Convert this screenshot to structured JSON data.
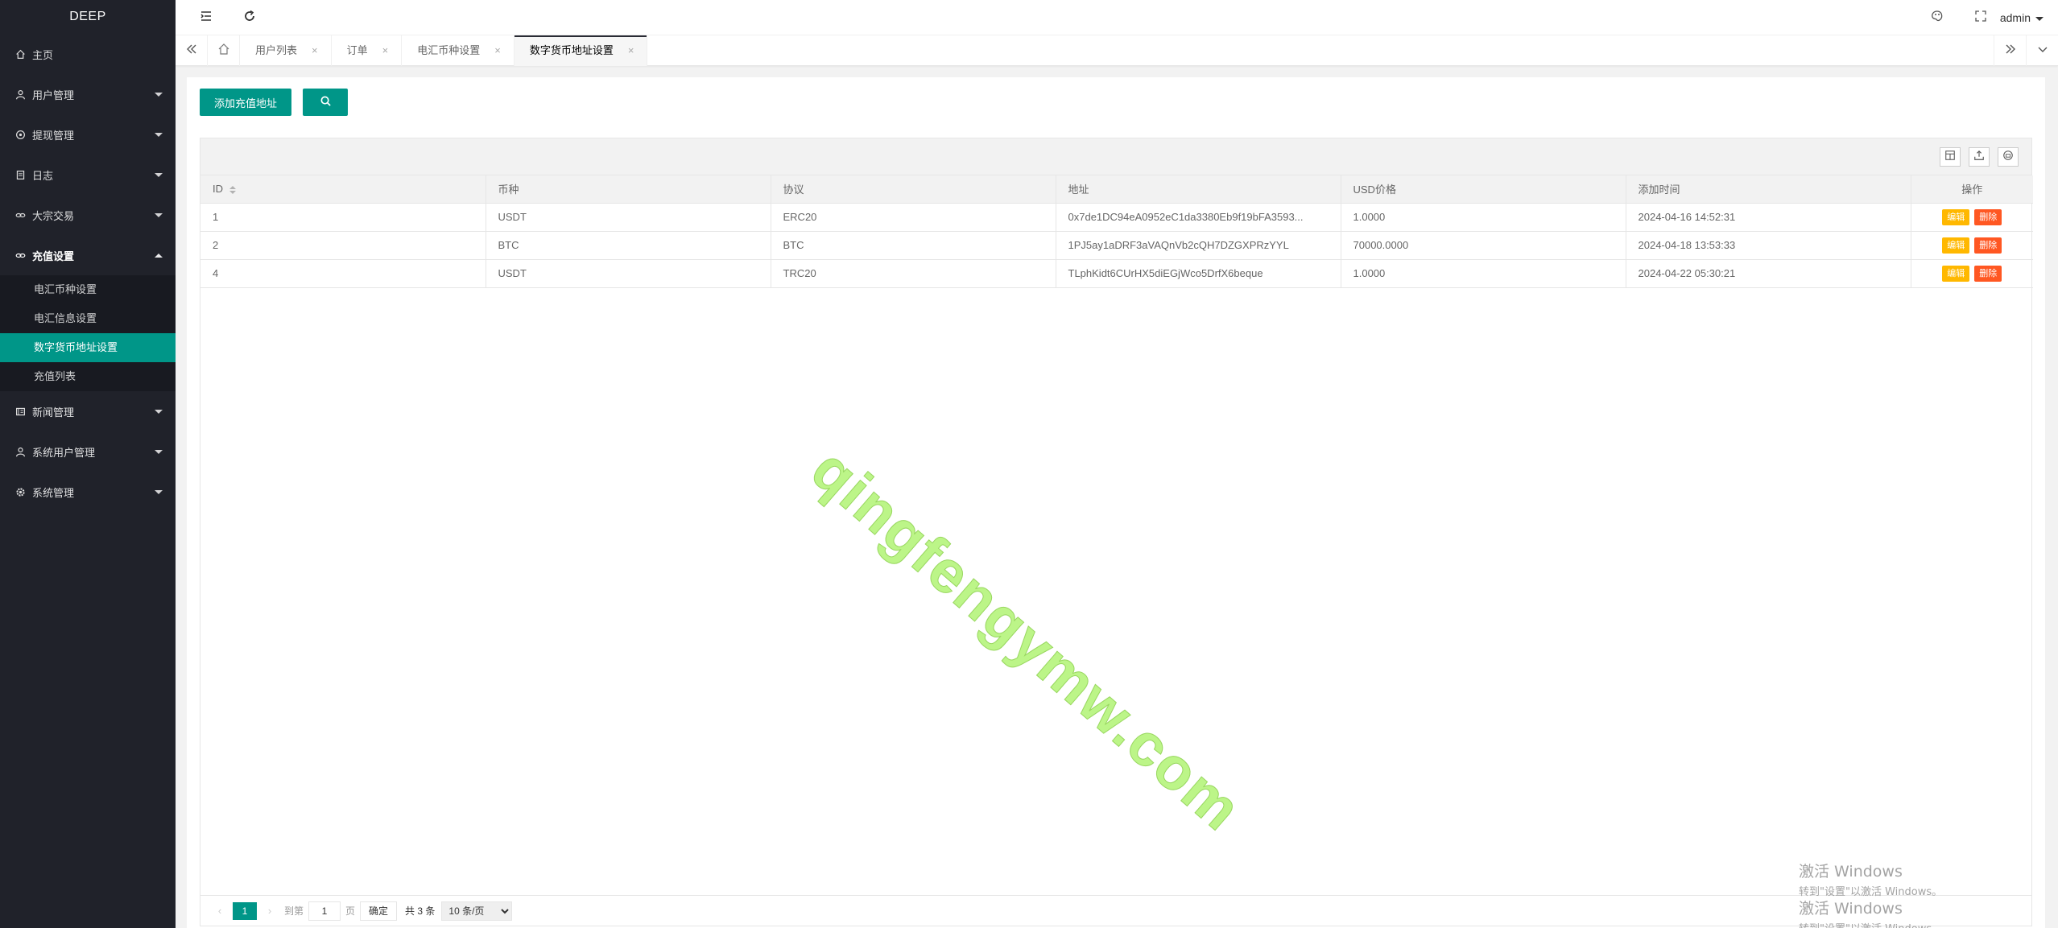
{
  "sidebar": {
    "logo": "DEEP",
    "menu": [
      {
        "label": "主页"
      },
      {
        "label": "用户管理"
      },
      {
        "label": "提现管理"
      },
      {
        "label": "日志"
      },
      {
        "label": "大宗交易"
      },
      {
        "label": "充值设置"
      },
      {
        "label": "新闻管理"
      },
      {
        "label": "系统用户管理"
      },
      {
        "label": "系统管理"
      }
    ],
    "submenu": [
      {
        "label": "电汇币种设置"
      },
      {
        "label": "电汇信息设置"
      },
      {
        "label": "数字货币地址设置"
      },
      {
        "label": "充值列表"
      }
    ]
  },
  "topbar": {
    "user": "admin"
  },
  "tabs": [
    {
      "label": "用户列表"
    },
    {
      "label": "订单"
    },
    {
      "label": "电汇币种设置"
    },
    {
      "label": "数字货币地址设置"
    }
  ],
  "tab_close": "×",
  "toolbar": {
    "add_label": "添加充值地址"
  },
  "table": {
    "headers": [
      "ID",
      "币种",
      "协议",
      "地址",
      "USD价格",
      "添加时间",
      "操作"
    ],
    "rows": [
      {
        "id": "1",
        "coin": "USDT",
        "protocol": "ERC20",
        "address": "0x7de1DC94eA0952eC1da3380Eb9f19bFA3593...",
        "price": "1.0000",
        "time": "2024-04-16 14:52:31"
      },
      {
        "id": "2",
        "coin": "BTC",
        "protocol": "BTC",
        "address": "1PJ5ay1aDRF3aVAQnVb2cQH7DZGXPRzYYL",
        "price": "70000.0000",
        "time": "2024-04-18 13:53:33"
      },
      {
        "id": "4",
        "coin": "USDT",
        "protocol": "TRC20",
        "address": "TLphKidt6CUrHX5diEGjWco5DrfX6beque",
        "price": "1.0000",
        "time": "2024-04-22 05:30:21"
      }
    ],
    "edit_label": "编辑",
    "delete_label": "删除"
  },
  "pager": {
    "current": "1",
    "goto_label": "到第",
    "page_value": "1",
    "page_unit": "页",
    "confirm_label": "确定",
    "total": "共 3 条",
    "limit": "10 条/页"
  },
  "watermark": "qingfengymw.com",
  "windows_activation": {
    "line1": "激活 Windows",
    "line2": "转到\"设置\"以激活 Windows。"
  },
  "colors": {
    "sidebar_bg": "#20222a",
    "accent": "#009688",
    "edit": "#ffb800",
    "delete": "#ff5722"
  }
}
